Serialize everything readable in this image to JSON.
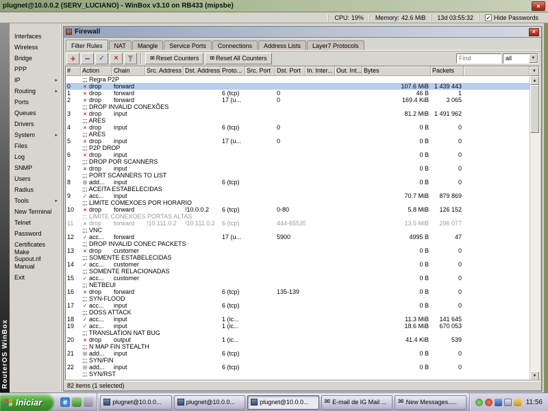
{
  "titlebar": {
    "title": "plugnet@10.0.0.2 (SERV_LUCIANO) - WinBox v3.10 on RB433 (mipsbe)"
  },
  "statsbar": {
    "cpu_label": "CPU:",
    "cpu_value": "19%",
    "memory_label": "Memory:",
    "memory_value": "42.6 MiB",
    "uptime": "13d 03:55:32",
    "hide_passwords_label": "Hide Passwords",
    "hide_passwords_checked": true
  },
  "sidebar": {
    "brand": "RouterOS WinBox",
    "items": [
      {
        "label": "Interfaces",
        "arrow": false
      },
      {
        "label": "Wireless",
        "arrow": false
      },
      {
        "label": "Bridge",
        "arrow": false
      },
      {
        "label": "PPP",
        "arrow": false
      },
      {
        "label": "IP",
        "arrow": true
      },
      {
        "label": "Routing",
        "arrow": true
      },
      {
        "label": "Ports",
        "arrow": false
      },
      {
        "label": "Queues",
        "arrow": false
      },
      {
        "label": "Drivers",
        "arrow": false
      },
      {
        "label": "System",
        "arrow": true
      },
      {
        "label": "Files",
        "arrow": false
      },
      {
        "label": "Log",
        "arrow": false
      },
      {
        "label": "SNMP",
        "arrow": false
      },
      {
        "label": "Users",
        "arrow": false
      },
      {
        "label": "Radius",
        "arrow": false
      },
      {
        "label": "Tools",
        "arrow": true
      },
      {
        "label": "New Terminal",
        "arrow": false
      },
      {
        "label": "Telnet",
        "arrow": false
      },
      {
        "label": "Password",
        "arrow": false
      },
      {
        "label": "Certificates",
        "arrow": false
      },
      {
        "label": "Make Supout.rif",
        "arrow": false
      },
      {
        "label": "Manual",
        "arrow": false
      },
      {
        "label": "Exit",
        "arrow": false
      }
    ]
  },
  "firewall": {
    "title": "Firewall",
    "tabs": [
      "Filter Rules",
      "NAT",
      "Mangle",
      "Service Ports",
      "Connections",
      "Address Lists",
      "Layer7 Protocols"
    ],
    "active_tab": "Filter Rules",
    "toolbar": {
      "reset_counters": {
        "icon": "00",
        "label": "Reset Counters"
      },
      "reset_all_counters": {
        "icon": "00",
        "label": "Reset All Counters"
      },
      "find_placeholder": "Find",
      "filter_value": "all"
    },
    "columns": [
      "#",
      "Action",
      "Chain",
      "Src. Address",
      "Dst. Address",
      "Proto...",
      "Src. Port",
      "Dst. Port",
      "In. Inter...",
      "Out. Int...",
      "Bytes",
      "Packets"
    ],
    "rows": [
      {
        "t": "c",
        "text": ";;; Regra P2P"
      },
      {
        "t": "r",
        "n": "0",
        "icon": "drop",
        "action": "drop",
        "chain": "forward",
        "bytes": "107.6 MiB",
        "packets": "1 439 443",
        "sel": true
      },
      {
        "t": "r",
        "n": "1",
        "icon": "drop",
        "action": "drop",
        "chain": "forward",
        "proto": "6 (tcp)",
        "dport": "0",
        "bytes": "46 B",
        "packets": "1"
      },
      {
        "t": "r",
        "n": "2",
        "icon": "drop",
        "action": "drop",
        "chain": "forward",
        "proto": "17 (u...",
        "dport": "0",
        "bytes": "169.4 KiB",
        "packets": "3 065"
      },
      {
        "t": "c",
        "text": ";;; DROP INVALID CONEXÕES"
      },
      {
        "t": "r",
        "n": "3",
        "icon": "drop",
        "action": "drop",
        "chain": "input",
        "bytes": "81.2 MiB",
        "packets": "1 491 962"
      },
      {
        "t": "c",
        "text": ";;; ARES"
      },
      {
        "t": "r",
        "n": "4",
        "icon": "drop",
        "action": "drop",
        "chain": "input",
        "proto": "6 (tcp)",
        "dport": "0",
        "bytes": "0 B",
        "packets": "0"
      },
      {
        "t": "c",
        "text": ";;; ARES"
      },
      {
        "t": "r",
        "n": "5",
        "icon": "drop",
        "action": "drop",
        "chain": "input",
        "proto": "17 (u...",
        "dport": "0",
        "bytes": "0 B",
        "packets": "0"
      },
      {
        "t": "c",
        "text": ";;; P2P DROP"
      },
      {
        "t": "r",
        "n": "6",
        "icon": "drop",
        "action": "drop",
        "chain": "input",
        "bytes": "0 B",
        "packets": "0"
      },
      {
        "t": "c",
        "text": ";;; DROP POR SCANNERS"
      },
      {
        "t": "r",
        "n": "7",
        "icon": "drop",
        "action": "drop",
        "chain": "input",
        "bytes": "0 B",
        "packets": "0"
      },
      {
        "t": "c",
        "text": ";;; PORT SCANNERS TO LIST"
      },
      {
        "t": "r",
        "n": "8",
        "icon": "add",
        "action": "add...",
        "chain": "input",
        "proto": "6 (tcp)",
        "bytes": "0 B",
        "packets": "0"
      },
      {
        "t": "c",
        "text": ";;; ACEITA ESTABELECIDAS"
      },
      {
        "t": "r",
        "n": "9",
        "icon": "accept",
        "action": "acc...",
        "chain": "input",
        "bytes": "70.7 MiB",
        "packets": "879 869"
      },
      {
        "t": "c",
        "text": ";;; LIMITE COMEXOES POR HORARIO"
      },
      {
        "t": "r",
        "n": "10",
        "icon": "drop",
        "action": "drop",
        "chain": "forward",
        "dst": "!10.0.0.2",
        "proto": "6 (tcp)",
        "dport": "0-80",
        "bytes": "5.8 MiB",
        "packets": "126 152"
      },
      {
        "t": "c",
        "text": ";;; LIMITE CONEXOES PORTAS ALTAS",
        "dis": true
      },
      {
        "t": "r",
        "n": "11",
        "icon": "drop",
        "action": "drop",
        "chain": "forward",
        "src": "!10.111.0.2",
        "dst": "!10.111.0.2",
        "proto": "6 (tcp)",
        "dport": "444-65535",
        "bytes": "13.5 MiB",
        "packets": "296 077",
        "dis": true
      },
      {
        "t": "c",
        "text": ";;; VNC"
      },
      {
        "t": "r",
        "n": "12",
        "icon": "accept",
        "action": "acc...",
        "chain": "forward",
        "proto": "17 (u...",
        "dport": "5900",
        "bytes": "4995 B",
        "packets": "47"
      },
      {
        "t": "c",
        "text": ";;; DROP INVALID CONEC PACKETS"
      },
      {
        "t": "r",
        "n": "13",
        "icon": "drop",
        "action": "drop",
        "chain": "customer",
        "bytes": "0 B",
        "packets": "0"
      },
      {
        "t": "c",
        "text": ";;; SOMENTE ESTABELECIDAS"
      },
      {
        "t": "r",
        "n": "14",
        "icon": "accept",
        "action": "acc...",
        "chain": "customer",
        "bytes": "0 B",
        "packets": "0"
      },
      {
        "t": "c",
        "text": ";;; SOMENTE RELACIONADAS"
      },
      {
        "t": "r",
        "n": "15",
        "icon": "accept",
        "action": "acc...",
        "chain": "customer",
        "bytes": "0 B",
        "packets": "0"
      },
      {
        "t": "c",
        "text": ";;; NETBEUI"
      },
      {
        "t": "r",
        "n": "16",
        "icon": "drop",
        "action": "drop",
        "chain": "forward",
        "proto": "6 (tcp)",
        "dport": "135-139",
        "bytes": "0 B",
        "packets": "0"
      },
      {
        "t": "c",
        "text": ";;; SYN-FLOOD"
      },
      {
        "t": "r",
        "n": "17",
        "icon": "accept",
        "action": "acc...",
        "chain": "input",
        "proto": "6 (tcp)",
        "bytes": "0 B",
        "packets": "0"
      },
      {
        "t": "c",
        "text": ";;; DOSS ATTACK"
      },
      {
        "t": "r",
        "n": "18",
        "icon": "accept",
        "action": "acc...",
        "chain": "input",
        "proto": "1 (ic...",
        "bytes": "11.3 MiB",
        "packets": "141 645"
      },
      {
        "t": "r",
        "n": "19",
        "icon": "accept",
        "action": "acc...",
        "chain": "input",
        "proto": "1 (ic...",
        "bytes": "18.6 MiB",
        "packets": "670 053"
      },
      {
        "t": "c",
        "text": ";;; TRANSLATION NAT BUG"
      },
      {
        "t": "r",
        "n": "20",
        "icon": "drop",
        "action": "drop",
        "chain": "output",
        "proto": "1 (ic...",
        "bytes": "41.4 KiB",
        "packets": "539"
      },
      {
        "t": "c",
        "text": ";;; N MAP FIN STEALTH"
      },
      {
        "t": "r",
        "n": "21",
        "icon": "add",
        "action": "add...",
        "chain": "input",
        "proto": "6 (tcp)",
        "bytes": "0 B",
        "packets": "0"
      },
      {
        "t": "c",
        "text": ";;; SYN/FIN"
      },
      {
        "t": "r",
        "n": "22",
        "icon": "add",
        "action": "add...",
        "chain": "input",
        "proto": "6 (tcp)",
        "bytes": "0 B",
        "packets": "0"
      },
      {
        "t": "c",
        "text": ";;; SYN/RST"
      }
    ],
    "status": "82 items (1 selected)"
  },
  "taskbar": {
    "start_label": "Iniciar",
    "tasks": [
      {
        "label": "plugnet@10.0.0...",
        "icon": "winbox",
        "active": false
      },
      {
        "label": "plugnet@10.0.0...",
        "icon": "winbox",
        "active": false
      },
      {
        "label": "plugnet@10.0.0...",
        "icon": "winbox",
        "active": true
      },
      {
        "label": "E-mail de IG Mail ...",
        "icon": "mail",
        "active": false
      },
      {
        "label": "New Messages.....",
        "icon": "mail",
        "active": false
      }
    ],
    "clock": "11:56"
  },
  "colors": {
    "desktop": "#7D9456",
    "selection": "#B9CEEC",
    "titlebar": "#8FA07A",
    "start_button_green": "#3F9A31",
    "close_button_red": "#B03A2A",
    "disabled_text": "#9B9B9B"
  }
}
